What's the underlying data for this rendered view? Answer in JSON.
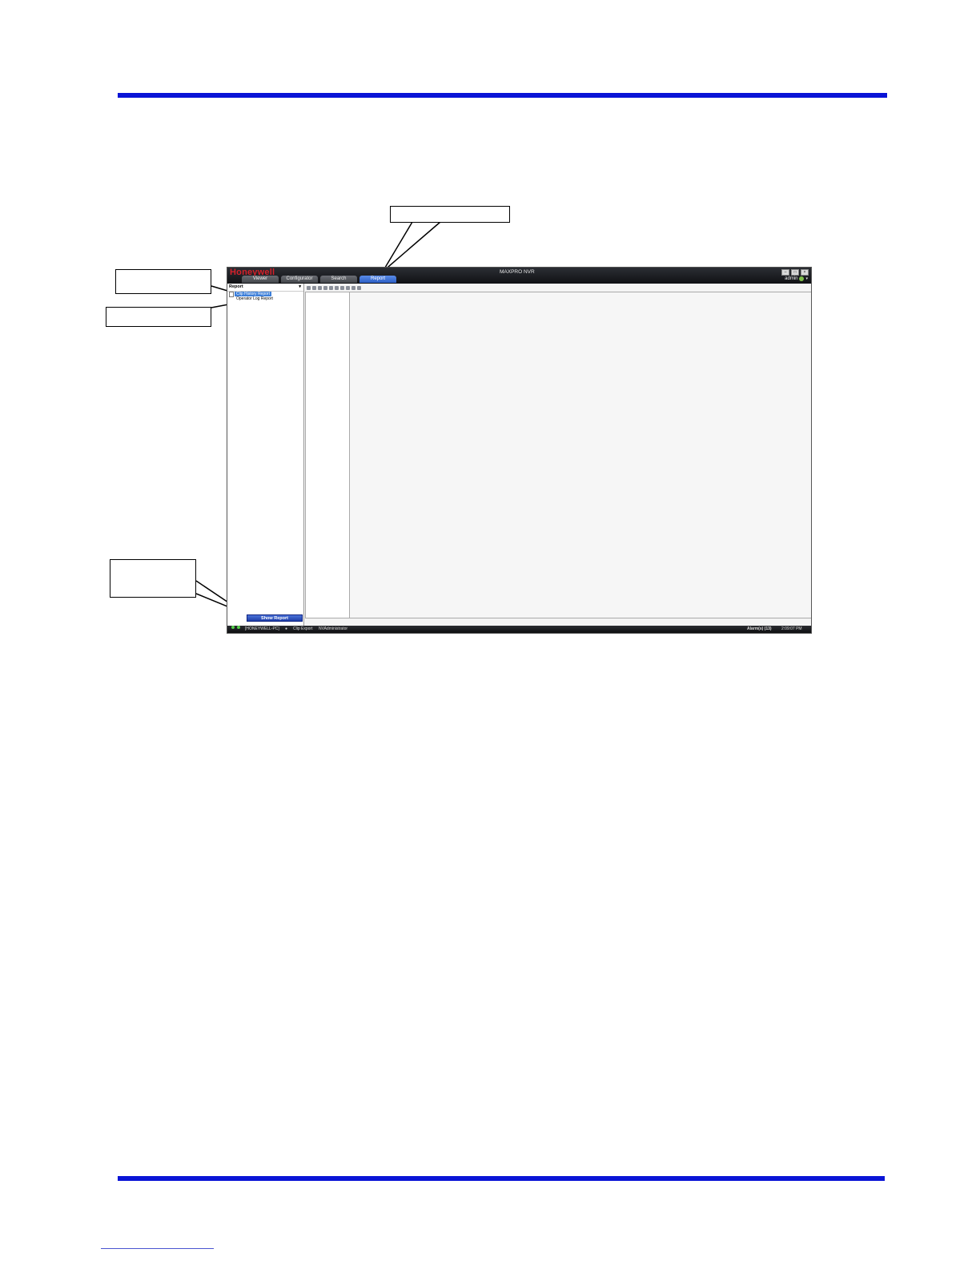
{
  "app": {
    "logo": "Honeywell",
    "title": "MAXPRO NVR",
    "tabs": [
      {
        "label": "Viewer"
      },
      {
        "label": "Configurator"
      },
      {
        "label": "Search"
      },
      {
        "label": "Report"
      }
    ],
    "active_tab": "Report",
    "user": "admin",
    "panel_title": "Report",
    "reports": [
      {
        "label": "Clip History Report"
      },
      {
        "label": "Operator Log Report"
      }
    ],
    "show_report_label": "Show Report",
    "status": {
      "host": "[HONEYWELL-PC]",
      "clip_export": "Clip Export",
      "login": "NVAdministrator",
      "alarms": "Alarm(s) (13)",
      "time": "2:09:07 PM"
    }
  },
  "colors": {
    "rule": "#0a14d6",
    "logo": "#d5202a",
    "active_tab": "#2d5fc5",
    "selected_item": "#3d7fd9"
  }
}
